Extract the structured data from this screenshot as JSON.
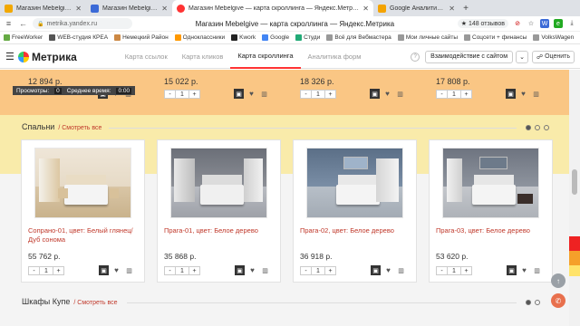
{
  "browser": {
    "tabs": [
      {
        "title": "Магазин Mebelgive — сп",
        "color": "#f2a800"
      },
      {
        "title": "Магазин Mebelgive — ск",
        "color": "#3b6ad7"
      },
      {
        "title": "Магазин Mebelgive — карта скроллинга — Яндекс.Метрика",
        "color": "#ff3333"
      },
      {
        "title": "Google Аналитика | Свод",
        "color": "#f4a300"
      }
    ],
    "address": "metrika.yandex.ru",
    "page_title": "Магазин Mebelgive — карта скроллинга — Яндекс.Метрика",
    "reviews": "148 отзывов",
    "bookmarks": [
      {
        "label": "FreeWorker",
        "color": "#6a4"
      },
      {
        "label": "WEB-студия КРЕА",
        "color": "#555"
      },
      {
        "label": "Немецкий Район",
        "color": "#c84"
      },
      {
        "label": "Одноклассники",
        "color": "#f90"
      },
      {
        "label": "Kwork",
        "color": "#222"
      },
      {
        "label": "Google",
        "color": "#4285f4"
      },
      {
        "label": "Студи",
        "color": "#2a7"
      },
      {
        "label": "Всё для Вебмастера",
        "color": "#999"
      },
      {
        "label": "Мои личные сайты",
        "color": "#999"
      },
      {
        "label": "Соцсети + финансы",
        "color": "#999"
      },
      {
        "label": "VolksWagen",
        "color": "#999"
      }
    ]
  },
  "metrika": {
    "brand": "Метрика",
    "tabs": [
      "Карта ссылок",
      "Карта кликов",
      "Карта скроллинга",
      "Аналитика форм"
    ],
    "active_tab": 2,
    "interaction_select": "Взаимодействие с сайтом",
    "rate_label": "Оценить"
  },
  "stats_overlay": {
    "views_label": "Просмотры:",
    "views_value": "0",
    "avg_time_label": "Среднее время:",
    "avg_time_value": "0:00"
  },
  "top_row": {
    "prices": [
      "12 894 р.",
      "15 022 р.",
      "18 326 р.",
      "17 808 р."
    ],
    "quantity": "1"
  },
  "sections": [
    {
      "title": "Спальни",
      "link": "Смотреть все"
    },
    {
      "title": "Шкафы Купе",
      "link": "Смотреть все"
    }
  ],
  "products": [
    {
      "title": "Сопрано-01, цвет: Белый глянец/Дуб сонома",
      "price": "55 762 р.",
      "quantity": "1"
    },
    {
      "title": "Прага-01, цвет: Белое дерево",
      "price": "35 868 р.",
      "quantity": "1"
    },
    {
      "title": "Прага-02, цвет: Белое дерево",
      "price": "36 918 р.",
      "quantity": "1"
    },
    {
      "title": "Прага-03, цвет: Белое дерево",
      "price": "53 620 р.",
      "quantity": "1"
    }
  ],
  "icons": {
    "cart": "cart-icon",
    "like": "heart-icon",
    "compare": "compare-icon"
  },
  "colors": {
    "heat_hot": "#ffa028",
    "heat_warm": "#ffe150",
    "accent_red": "#c0392b",
    "metrika_red": "#ff3333"
  }
}
